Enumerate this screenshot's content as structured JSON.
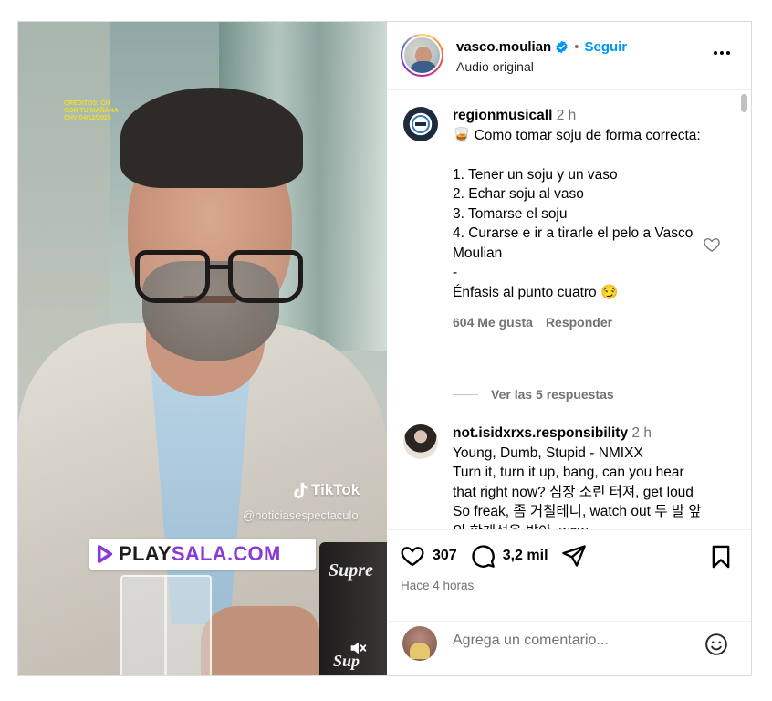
{
  "video": {
    "credits": "CRÉDITOS: CH\nCON TU MAÑANA\nCHV 04/12/2025",
    "watermark_app": "TikTok",
    "watermark_handle": "@noticiasespectaculo",
    "brand_prefix": "PLAY",
    "brand_suffix": "SALA.COM",
    "mug_text": "Supre",
    "mug_text_2": "Sup"
  },
  "post": {
    "username": "vasco.moulian",
    "separator": "•",
    "follow_label": "Seguir",
    "audio_label": "Audio original"
  },
  "comments": [
    {
      "user": "regionmusicall",
      "time": "2 h",
      "lines": [
        "🥃 Como tomar soju de forma correcta:",
        "",
        "1. Tener un soju y un vaso",
        "2. Echar soju al vaso",
        "3. Tomarse el soju",
        "4. Curarse e ir a tirarle el pelo a Vasco Moulian",
        "-",
        "Énfasis al punto cuatro 😏"
      ],
      "likes": "604 Me gusta",
      "reply_label": "Responder"
    },
    {
      "user": "not.isidxrxs.responsibility",
      "time": "2 h",
      "lines": [
        "Young, Dumb, Stupid - NMIXX",
        "Turn it, turn it up, bang, can you hear that right now? 심장 소린 터져, get loud So freak, 좀 거칠테니, watch out 두 발 앞의 한계선을 밟아, wow"
      ]
    }
  ],
  "view_replies_label": "Ver las 5 respuestas",
  "actions": {
    "likes_count": "307",
    "comments_count": "3,2 mil",
    "posted_ago": "Hace 4 horas"
  },
  "add_comment": {
    "placeholder": "Agrega un comentario..."
  },
  "colors": {
    "accent": "#0095f6",
    "muted": "#737373",
    "brand_purple": "#8a3ad6"
  }
}
